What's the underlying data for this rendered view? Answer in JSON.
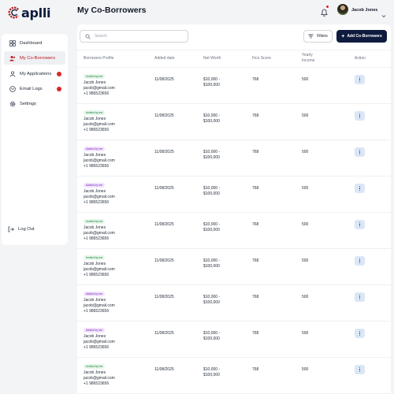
{
  "app": {
    "logo_text": "aplli",
    "brand_color": "#0f1b3d",
    "accent": "#b91c1c"
  },
  "sidebar": {
    "items": [
      {
        "label": "Dashboard",
        "icon": "grid-icon",
        "active": false,
        "badge": false
      },
      {
        "label": "My Co-Borrowers",
        "icon": "users-icon",
        "active": true,
        "badge": false
      },
      {
        "label": "My Applications",
        "icon": "user-icon",
        "active": false,
        "badge": true
      },
      {
        "label": "Email Logs",
        "icon": "mail-icon",
        "active": false,
        "badge": true
      },
      {
        "label": "Settings",
        "icon": "gear-icon",
        "active": false,
        "badge": false
      }
    ],
    "logout_label": "Log Out"
  },
  "header": {
    "title": "My Co-Borrowers",
    "user_name": "Jacob Jones"
  },
  "toolbar": {
    "search_placeholder": "Search",
    "filters_label": "Filters",
    "add_label": "Add Co-Borrowers"
  },
  "table": {
    "headers": {
      "profile": "Borrowers Profile",
      "added": "Added date",
      "net": "Net Worth",
      "fico": "Fico Score",
      "income_1": "Yearly",
      "income_2": "Income",
      "action": "Action"
    },
    "rows": [
      {
        "tag": "Invited by me",
        "tag_type": "invited",
        "name": "Jacob Jones",
        "email": "jacob@gmail.com",
        "phone": "+1 986523656",
        "added": "11/08/2025",
        "net_1": "$10,000 -",
        "net_2": "$100,000",
        "fico": "768",
        "income": "500"
      },
      {
        "tag": "Invited by me",
        "tag_type": "invited",
        "name": "Jacob Jones",
        "email": "jacob@gmail.com",
        "phone": "+1 986523656",
        "added": "11/08/2025",
        "net_1": "$10,000 -",
        "net_2": "$100,000",
        "fico": "768",
        "income": "500"
      },
      {
        "tag": "Added by me",
        "tag_type": "added",
        "name": "Jacob Jones",
        "email": "jacob@gmail.com",
        "phone": "+1 986523656",
        "added": "11/08/2025",
        "net_1": "$10,000 -",
        "net_2": "$100,000",
        "fico": "768",
        "income": "500"
      },
      {
        "tag": "Added by me",
        "tag_type": "added",
        "name": "Jacob Jones",
        "email": "jacob@gmail.com",
        "phone": "+1 986523656",
        "added": "11/08/2025",
        "net_1": "$10,000 -",
        "net_2": "$100,000",
        "fico": "768",
        "income": "500"
      },
      {
        "tag": "Invited by me",
        "tag_type": "invited",
        "name": "Jacob Jones",
        "email": "jacob@gmail.com",
        "phone": "+1 986523656",
        "added": "11/08/2025",
        "net_1": "$10,000 -",
        "net_2": "$100,000",
        "fico": "768",
        "income": "500"
      },
      {
        "tag": "Invited by me",
        "tag_type": "invited",
        "name": "Jacob Jones",
        "email": "jacob@gmail.com",
        "phone": "+1 986523656",
        "added": "11/08/2025",
        "net_1": "$10,000 -",
        "net_2": "$100,000",
        "fico": "768",
        "income": "500"
      },
      {
        "tag": "Added by me",
        "tag_type": "added",
        "name": "Jacob Jones",
        "email": "jacob@gmail.com",
        "phone": "+1 986523656",
        "added": "11/08/2025",
        "net_1": "$10,000 -",
        "net_2": "$100,000",
        "fico": "768",
        "income": "500"
      },
      {
        "tag": "Added by me",
        "tag_type": "added",
        "name": "Jacob Jones",
        "email": "jacob@gmail.com",
        "phone": "+1 986523656",
        "added": "11/08/2025",
        "net_1": "$10,000 -",
        "net_2": "$100,000",
        "fico": "768",
        "income": "500"
      },
      {
        "tag": "Invited by me",
        "tag_type": "invited",
        "name": "Jacob Jones",
        "email": "jacob@gmail.com",
        "phone": "+1 986523656",
        "added": "11/08/2025",
        "net_1": "$10,000 -",
        "net_2": "$100,000",
        "fico": "768",
        "income": "500"
      }
    ]
  }
}
